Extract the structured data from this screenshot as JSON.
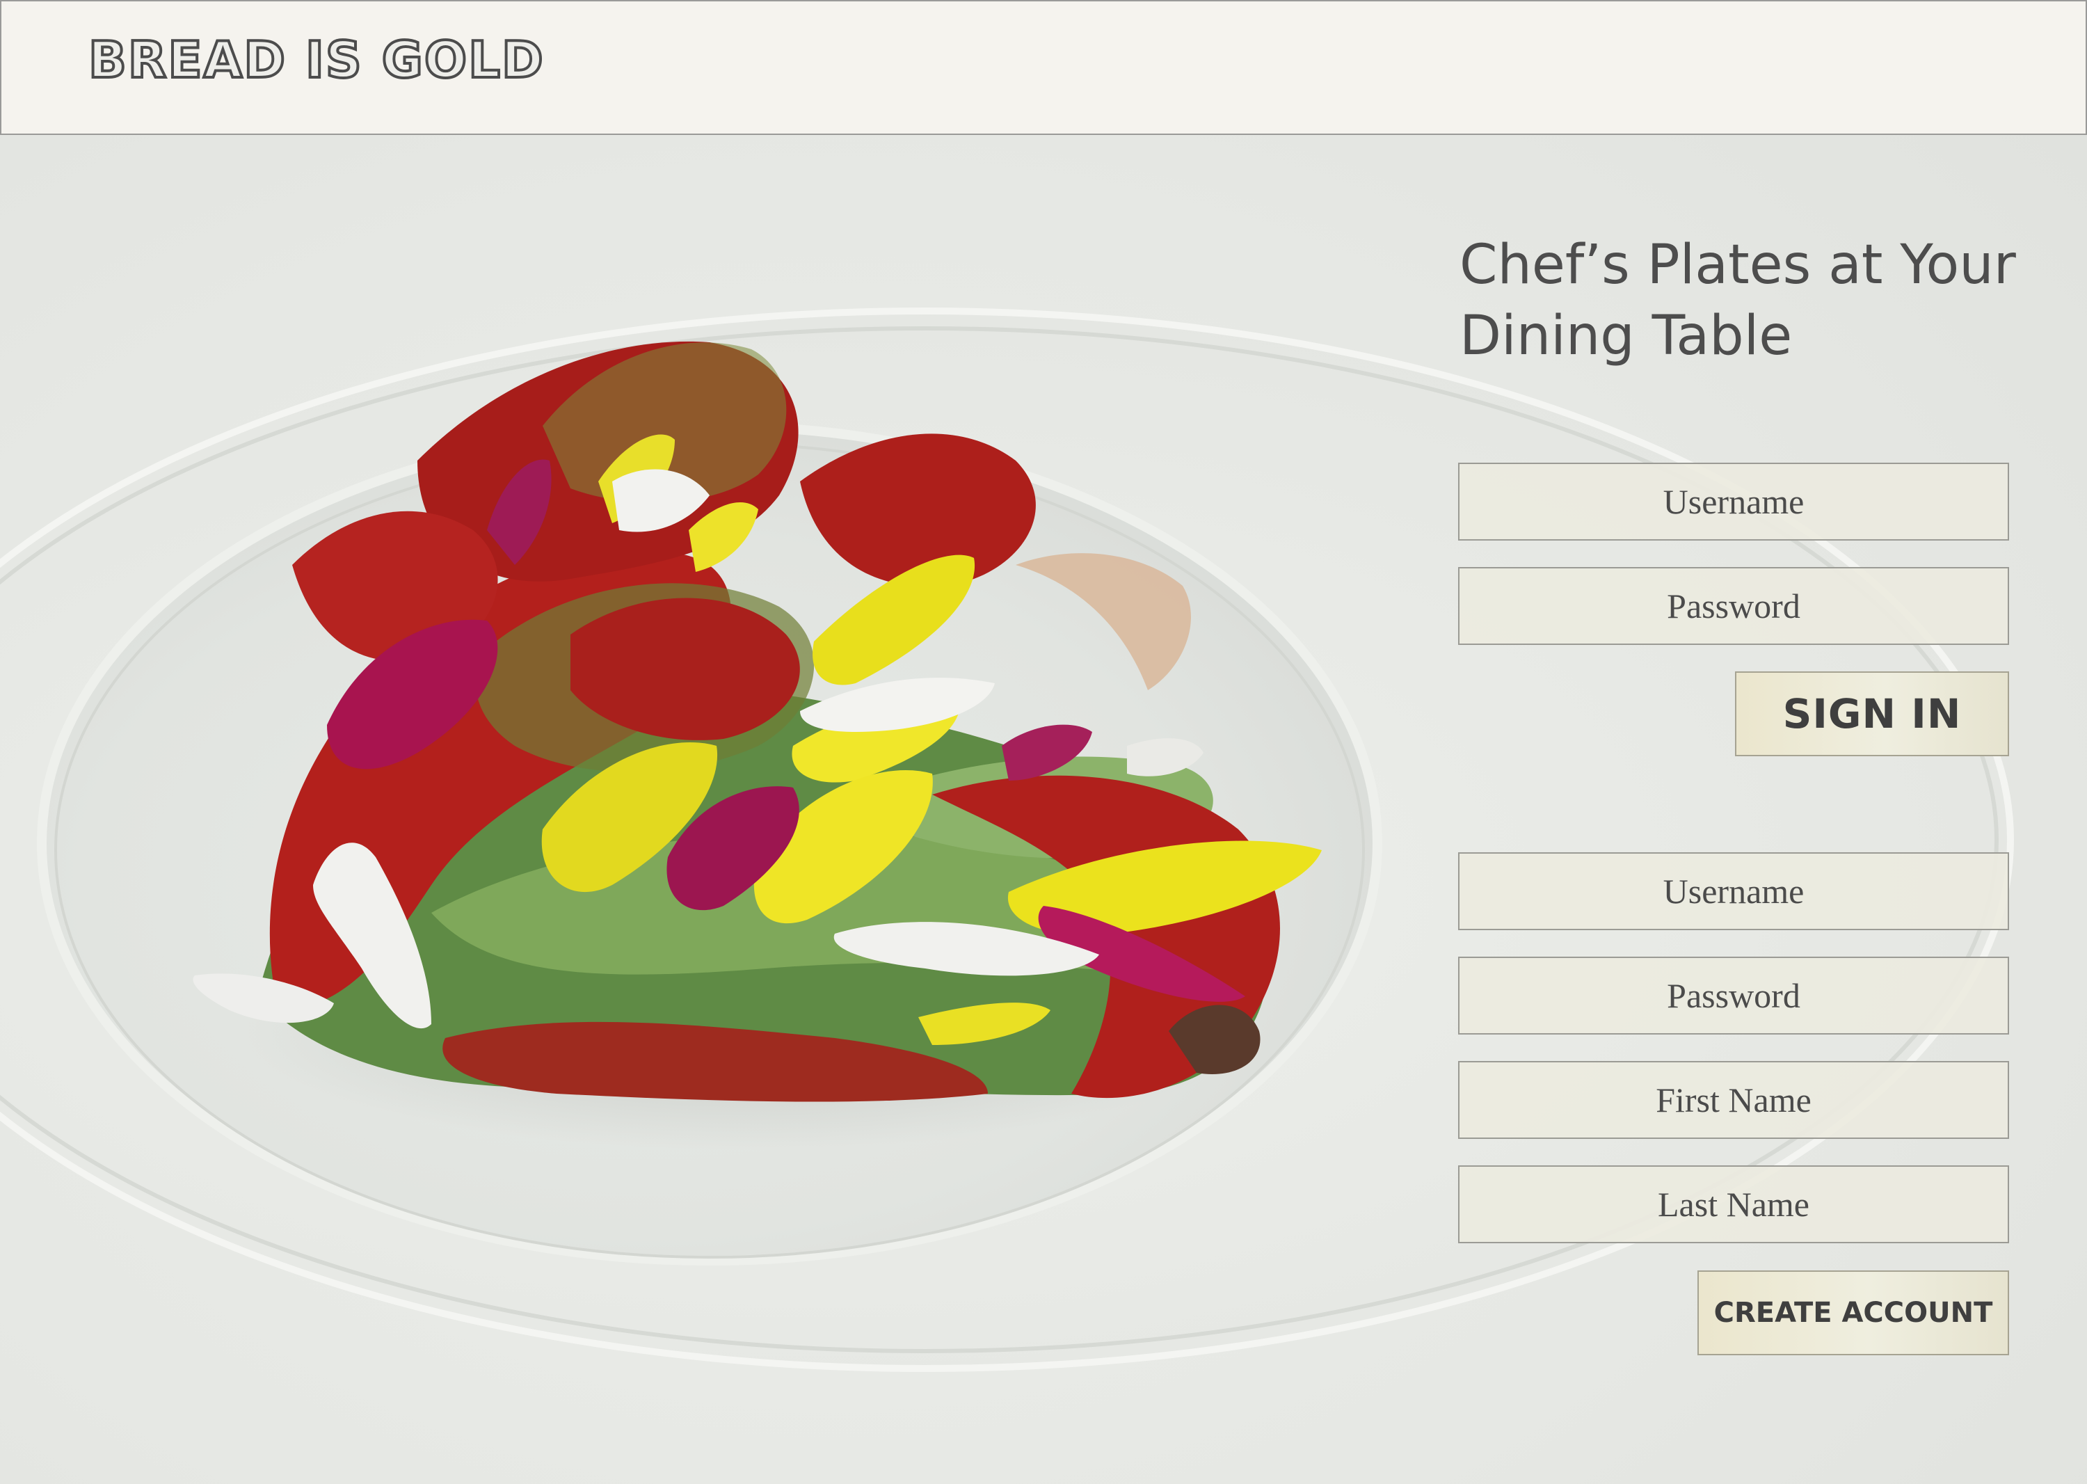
{
  "header": {
    "brand": "BREAD IS GOLD"
  },
  "hero": {
    "headline_line1": "Chef’s Plates at Your",
    "headline_line2": "Dining Table"
  },
  "sign_in": {
    "username_placeholder": "Username",
    "password_placeholder": "Password",
    "submit_label": "SIGN IN"
  },
  "create_account": {
    "username_placeholder": "Username",
    "password_placeholder": "Password",
    "first_name_placeholder": "First Name",
    "last_name_placeholder": "Last Name",
    "submit_label": "CREATE ACCOUNT"
  },
  "colors": {
    "header_bg": "#f5f3ee",
    "text": "#4d4d4d",
    "button_bg": "#ebe6cd",
    "field_bg": "#eceae0"
  }
}
